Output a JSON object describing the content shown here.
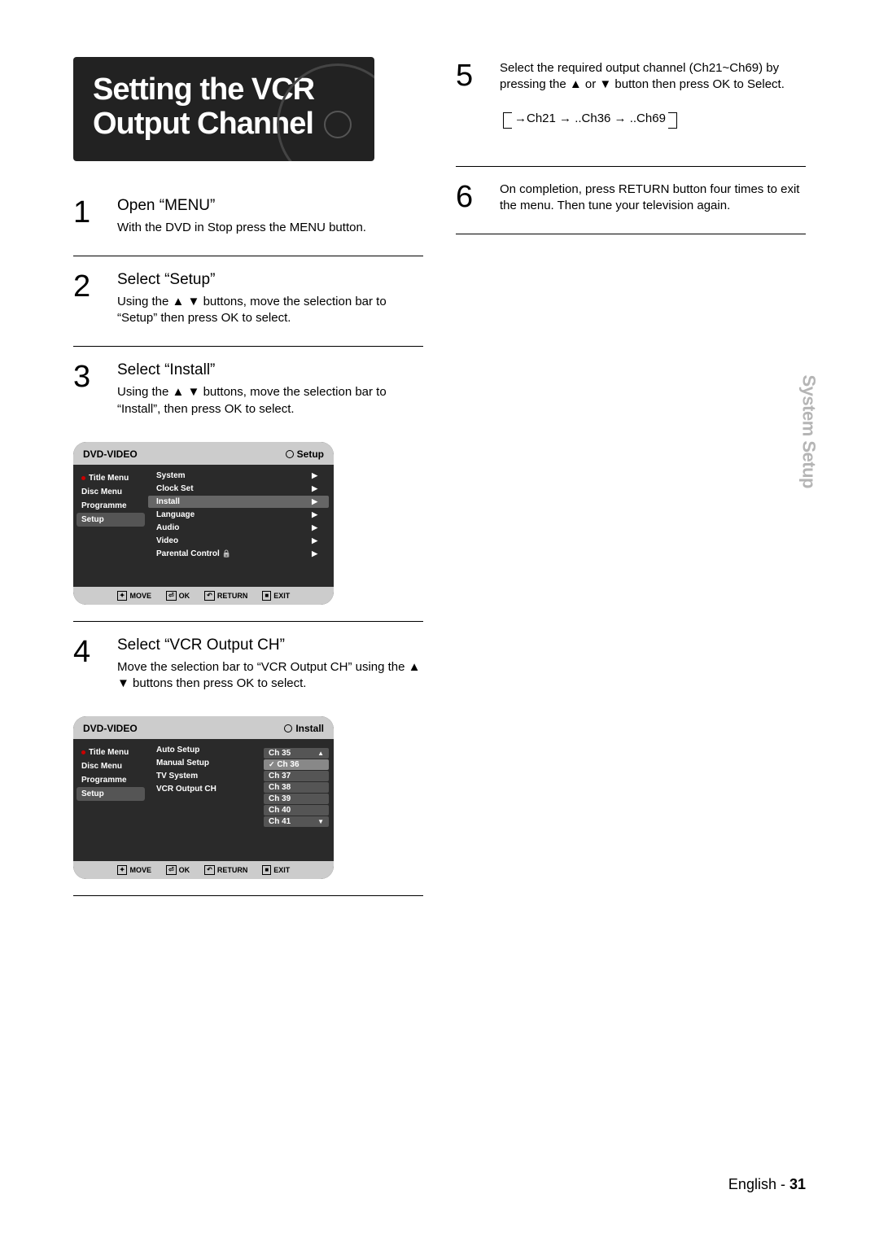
{
  "title": "Setting the VCR Output Channel",
  "side_tab": "System Setup",
  "footer_lang": "English",
  "footer_sep": " - ",
  "footer_page": "31",
  "steps": {
    "1": {
      "num": "1",
      "title": "Open “MENU”",
      "text": "With the DVD in Stop press the MENU button."
    },
    "2": {
      "num": "2",
      "title": "Select “Setup”",
      "text": "Using the ▲ ▼ buttons, move the selection bar to “Setup” then press OK to select."
    },
    "3": {
      "num": "3",
      "title": "Select “Install”",
      "text": "Using the ▲ ▼ buttons, move the selection bar to “Install”, then press OK to select."
    },
    "4": {
      "num": "4",
      "title": "Select “VCR Output CH”",
      "text": "Move the selection bar to “VCR Output CH” using the ▲ ▼ buttons then press OK to select."
    },
    "5": {
      "num": "5",
      "text": "Select the required output channel (Ch21~Ch69) by pressing the ▲ or ▼ button then press OK to Select.",
      "seq": "→Ch21 → ..Ch36 → ..Ch69"
    },
    "6": {
      "num": "6",
      "text": "On completion, press RETURN button four times to exit the menu. Then tune your television again."
    }
  },
  "osd1": {
    "header_left": "DVD-VIDEO",
    "header_right": "Setup",
    "nav": [
      "Title Menu",
      "Disc Menu",
      "Programme",
      "Setup"
    ],
    "nav_selected": 3,
    "rows": [
      "System",
      "Clock Set",
      "Install",
      "Language",
      "Audio",
      "Video",
      "Parental Control"
    ],
    "hl_row": 2,
    "footer": {
      "move": "MOVE",
      "ok": "OK",
      "return": "RETURN",
      "exit": "EXIT"
    }
  },
  "osd2": {
    "header_left": "DVD-VIDEO",
    "header_right": "Install",
    "nav": [
      "Title Menu",
      "Disc Menu",
      "Programme",
      "Setup"
    ],
    "nav_selected": 3,
    "rows": [
      "Auto Setup",
      "Manual Setup",
      "TV System",
      "VCR Output CH"
    ],
    "channels": [
      "Ch 35",
      "Ch 36",
      "Ch 37",
      "Ch 38",
      "Ch 39",
      "Ch 40",
      "Ch 41"
    ],
    "ch_selected": 1,
    "footer": {
      "move": "MOVE",
      "ok": "OK",
      "return": "RETURN",
      "exit": "EXIT"
    }
  }
}
